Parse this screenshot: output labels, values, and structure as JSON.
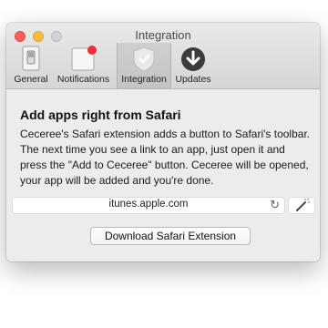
{
  "window": {
    "title": "Integration"
  },
  "tabs": [
    {
      "label": "General",
      "icon": "general-switch-icon",
      "selected": false
    },
    {
      "label": "Notifications",
      "icon": "notifications-icon",
      "selected": false,
      "badge_color": "#e8313a"
    },
    {
      "label": "Integration",
      "icon": "safari-extension-icon",
      "selected": true
    },
    {
      "label": "Updates",
      "icon": "download-arrow-icon",
      "selected": false
    }
  ],
  "main": {
    "heading": "Add apps right from Safari",
    "description": "Ceceree's Safari extension adds a button to Safari's toolbar. The next time you see a link to an app, just open it and press the \"Add to Ceceree\" button. Ceceree will be opened, your app will be added and you're done.",
    "url_field": {
      "value": "itunes.apple.com",
      "reload_icon": "reload-icon"
    },
    "extension_button_icon": "magic-wand-icon",
    "download_button_label": "Download Safari Extension"
  },
  "colors": {
    "close": "#fc605c",
    "minimize": "#fdbc40",
    "zoom": "#d3d3d3",
    "badge": "#e8313a",
    "window_bg": "#ececec"
  }
}
